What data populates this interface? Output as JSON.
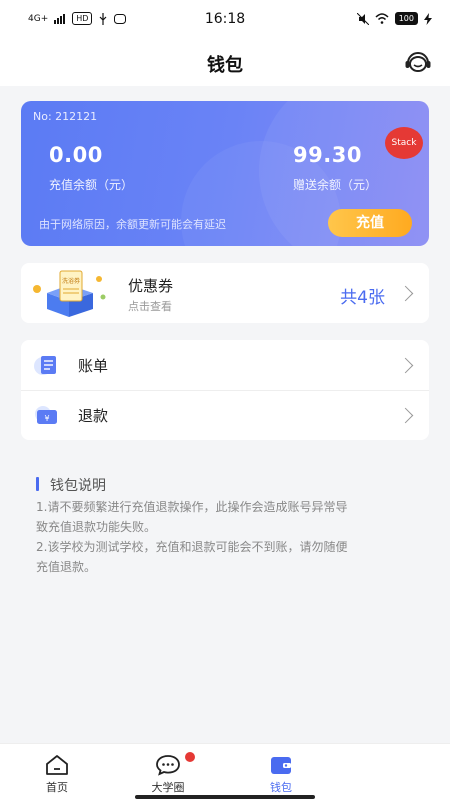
{
  "status_bar": {
    "signal": "4G+",
    "hd": "HD",
    "time": "16:18",
    "battery": "100"
  },
  "header": {
    "title": "钱包"
  },
  "card": {
    "card_no": "No: 212121",
    "badge": "Stack",
    "recharge_balance": "0.00",
    "recharge_label": "充值余额（元）",
    "gift_balance": "99.30",
    "gift_label": "赠送余额（元）",
    "notice": "由于网络原因，余额更新可能会有延迟",
    "topup_label": "充值"
  },
  "coupon": {
    "title": "优惠券",
    "subtitle": "点击查看",
    "count": "共4张",
    "illustration_text": "洗浴券"
  },
  "list": {
    "items": [
      {
        "label": "账单",
        "icon": "bill-icon"
      },
      {
        "label": "退款",
        "icon": "refund-wallet-icon"
      }
    ]
  },
  "description": {
    "title": "钱包说明",
    "lines": [
      "1.请不要频繁进行充值退款操作，此操作会造成账号异常导",
      "致充值退款功能失败。",
      "2.该学校为测试学校，充值和退款可能会不到账，请勿随便",
      "充值退款。"
    ]
  },
  "tabbar": {
    "tabs": [
      {
        "label": "首页",
        "icon": "home-icon"
      },
      {
        "label": "大学圈",
        "icon": "chat-bubble-icon"
      },
      {
        "label": "钱包",
        "icon": "wallet-icon"
      }
    ]
  },
  "colors": {
    "accent": "#4a6bf0",
    "card_gradient_start": "#5b7bf4",
    "card_gradient_end": "#8a8cf4",
    "topup": "#ffaa20",
    "badge": "#e53935"
  }
}
